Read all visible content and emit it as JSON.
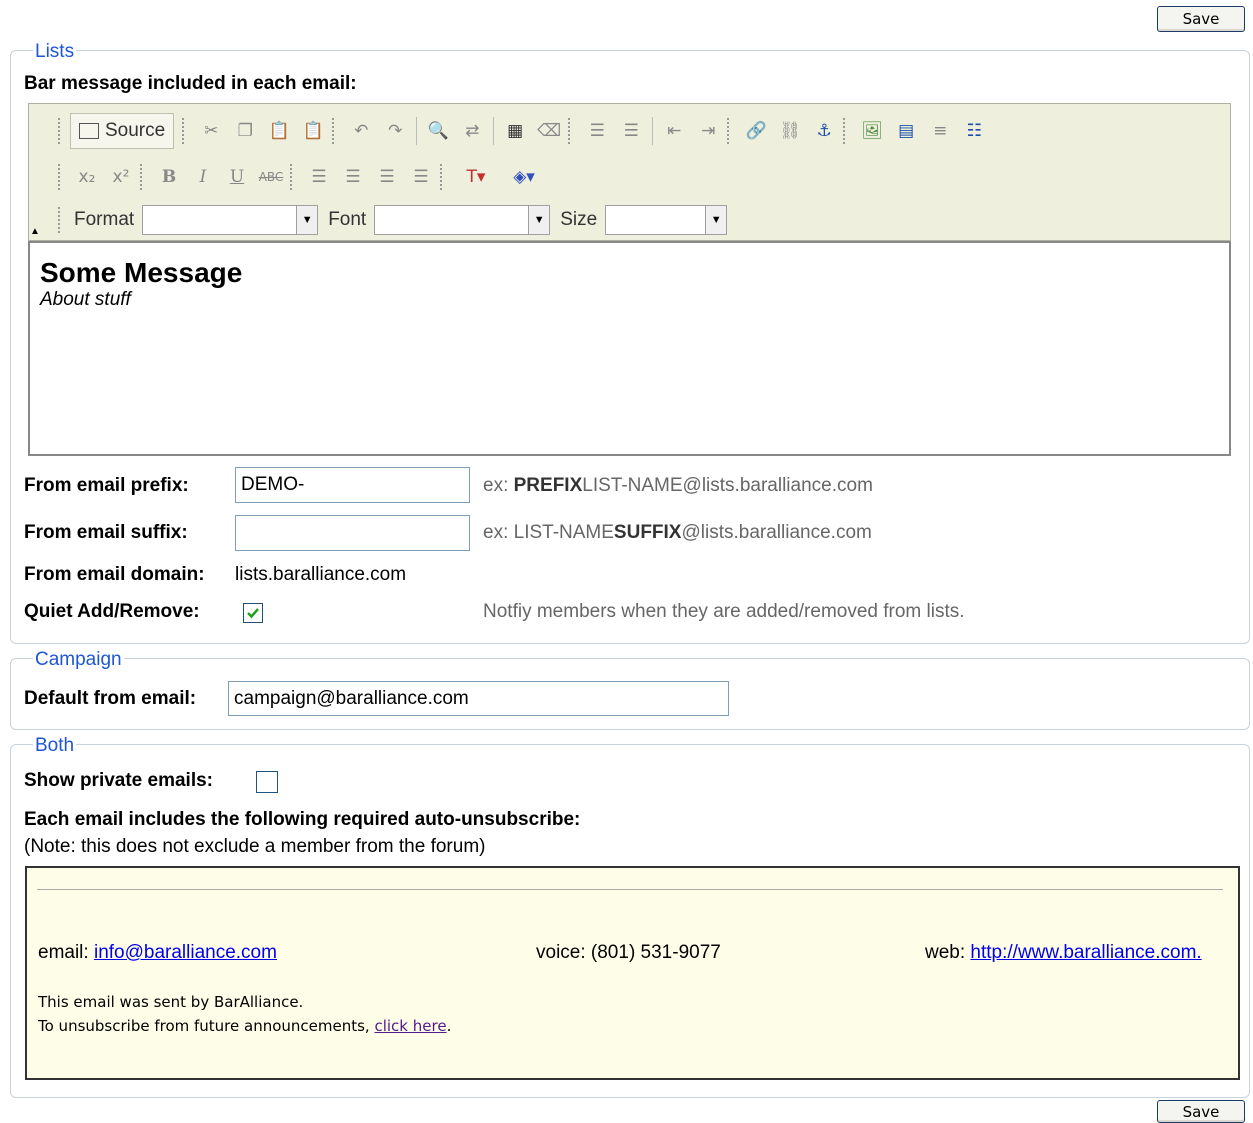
{
  "save_label": "Save",
  "lists": {
    "legend": "Lists",
    "bar_message_label": "Bar message included in each email:",
    "editor": {
      "source_label": "Source",
      "format_label": "Format",
      "font_label": "Font",
      "size_label": "Size",
      "content_heading": "Some Message",
      "content_italic": "About stuff"
    },
    "prefix": {
      "label": "From email prefix:",
      "value": "DEMO-",
      "hint_pre": "ex: ",
      "hint_bold": "PREFIX",
      "hint_post": "LIST-NAME@lists.baralliance.com"
    },
    "suffix": {
      "label": "From email suffix:",
      "value": "",
      "hint_pre": "ex: LIST-NAME",
      "hint_bold": "SUFFIX",
      "hint_post": "@lists.baralliance.com"
    },
    "domain": {
      "label": "From email domain:",
      "value": "lists.baralliance.com"
    },
    "quiet": {
      "label": "Quiet Add/Remove:",
      "checked": true,
      "hint": "Notfiy members when they are added/removed from lists."
    }
  },
  "campaign": {
    "legend": "Campaign",
    "default_from_label": "Default from email:",
    "default_from_value": "campaign@baralliance.com"
  },
  "both": {
    "legend": "Both",
    "show_private_label": "Show private emails:",
    "show_private_checked": false,
    "unsub_heading": "Each email includes the following required auto-unsubscribe:",
    "unsub_note": "(Note: this does not exclude a member from the forum)",
    "preview": {
      "email_label": "email: ",
      "email_link": "info@baralliance.com",
      "voice": "voice: (801) 531-9077",
      "web_label": "web: ",
      "web_link": "http://www.baralliance.com.",
      "sent_by": "This email was sent by BarAlliance.",
      "unsub_pre": "To unsubscribe from future announcements, ",
      "unsub_link": "click here",
      "unsub_post": "."
    }
  }
}
